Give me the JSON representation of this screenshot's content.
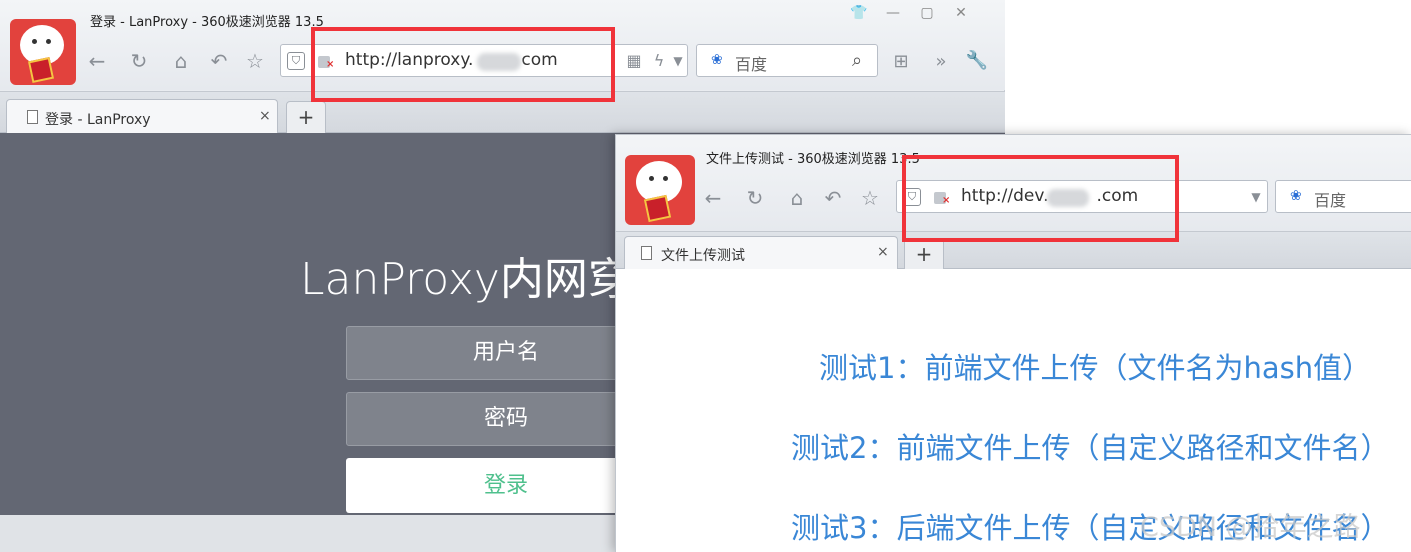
{
  "window1": {
    "title": "登录 - LanProxy - 360极速浏览器 13.5",
    "url": "http://lanproxy.",
    "url_suffix": "com",
    "search_label": "百度",
    "tab_label": "登录 - LanProxy",
    "tab_close": "×",
    "new_tab": "+",
    "page": {
      "title": "LanProxy内网穿",
      "username_placeholder": "用户名",
      "password_placeholder": "密码",
      "login_label": "登录"
    }
  },
  "window2": {
    "title": "文件上传测试 - 360极速浏览器 13.5",
    "url": "http://dev.",
    "url_suffix": ".com",
    "search_label": "百度",
    "tab_label": "文件上传测试",
    "tab_close": "×",
    "new_tab": "+",
    "links": [
      "测试1：前端文件上传（文件名为hash值）",
      "测试2：前端文件上传（自定义路径和文件名）",
      "测试3：后端文件上传（自定义路径和文件名）"
    ]
  },
  "watermark": "CSDN @拾年之路",
  "icons": {
    "back": "back-icon",
    "refresh": "refresh-icon",
    "home": "home-icon",
    "undo": "undo-icon",
    "favorite": "star-icon",
    "search": "search-icon",
    "tools": "wrench-icon"
  },
  "colors": {
    "highlight": "#f0333a",
    "link": "#3a87d6",
    "login_text": "#4fc08d",
    "page_bg": "#636773"
  }
}
